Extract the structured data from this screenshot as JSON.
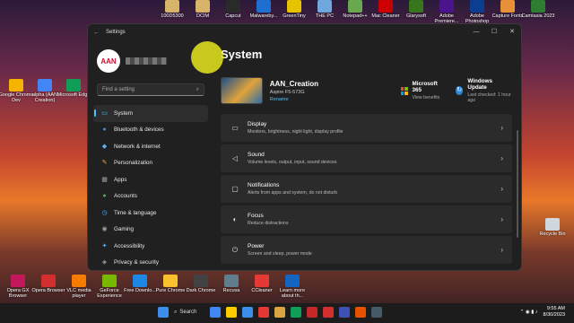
{
  "desktop": {
    "top_icons": [
      {
        "label": "100D5300",
        "color": "#d8b36a"
      },
      {
        "label": "DCIM",
        "color": "#d8b36a"
      },
      {
        "label": "Capcut",
        "color": "#2a2a2a"
      },
      {
        "label": "Malwareby...",
        "color": "#1f6fd1"
      },
      {
        "label": "GreenTiny",
        "color": "#e6c200"
      },
      {
        "label": "THE PC",
        "color": "#6fa8dc"
      },
      {
        "label": "Notepad++",
        "color": "#6aa84f"
      },
      {
        "label": "Mac Cleaner",
        "color": "#cc0000"
      },
      {
        "label": "Glarysoft",
        "color": "#38761d"
      },
      {
        "label": "Adobe Premiere...",
        "color": "#4a148c"
      },
      {
        "label": "Adobe Photoshop",
        "color": "#0b3d91"
      },
      {
        "label": "Capture Fonts",
        "color": "#e69138"
      },
      {
        "label": "Camtasia 2023",
        "color": "#2e7d32"
      }
    ],
    "left_icons": [
      {
        "label": "Google Chrome Dev",
        "color": "#f4b400"
      },
      {
        "label": "alpha (AAN Creation)",
        "color": "#4285f4"
      },
      {
        "label": "Microsoft Edge",
        "color": "#0f9d58"
      }
    ],
    "bottom_icons": [
      {
        "label": "Opera GX Browser",
        "color": "#c2185b"
      },
      {
        "label": "Opera Browser",
        "color": "#d32f2f"
      },
      {
        "label": "VLC media player",
        "color": "#f57c00"
      },
      {
        "label": "GeForce Experience",
        "color": "#76b900"
      },
      {
        "label": "Free Downlo...",
        "color": "#1e88e5"
      },
      {
        "label": "Pure Chrome",
        "color": "#fbc02d"
      },
      {
        "label": "Dark Chrome",
        "color": "#424242"
      },
      {
        "label": "Recuva",
        "color": "#607d8b"
      },
      {
        "label": "CCleaner",
        "color": "#e53935"
      },
      {
        "label": "Learn more about th...",
        "color": "#1565c0"
      }
    ],
    "recycle_bin": "Recycle Bin"
  },
  "window": {
    "title": "Settings",
    "back_glyph": "←",
    "controls": {
      "minimize": "—",
      "maximize": "☐",
      "close": "✕"
    }
  },
  "sidebar": {
    "avatar_text": "AAN",
    "search_placeholder": "Find a setting",
    "search_icon": "⌕",
    "items": [
      {
        "label": "System",
        "icon": "▭",
        "color": "#4cc2ff",
        "active": true
      },
      {
        "label": "Bluetooth & devices",
        "icon": "●",
        "color": "#3b8eea",
        "active": false
      },
      {
        "label": "Network & internet",
        "icon": "◆",
        "color": "#5fb2f0",
        "active": false
      },
      {
        "label": "Personalization",
        "icon": "✎",
        "color": "#e8a35a",
        "active": false
      },
      {
        "label": "Apps",
        "icon": "▦",
        "color": "#9aa0a6",
        "active": false
      },
      {
        "label": "Accounts",
        "icon": "●",
        "color": "#4caf50",
        "active": false
      },
      {
        "label": "Time & language",
        "icon": "◷",
        "color": "#5fb2f0",
        "active": false
      },
      {
        "label": "Gaming",
        "icon": "◉",
        "color": "#9aa0a6",
        "active": false
      },
      {
        "label": "Accessibility",
        "icon": "✦",
        "color": "#5fb2f0",
        "active": false
      },
      {
        "label": "Privacy & security",
        "icon": "◈",
        "color": "#9aa0a6",
        "active": false
      }
    ]
  },
  "main": {
    "title": "System",
    "device": {
      "name": "AAN_Creation",
      "model": "Aspire F5-573G",
      "rename": "Rename"
    },
    "quick_links": [
      {
        "title": "Microsoft 365",
        "sub": "View benefits"
      },
      {
        "title": "Windows Update",
        "sub": "Last checked: 1 hour ago"
      }
    ],
    "cards": [
      {
        "icon": "▭",
        "title": "Display",
        "sub": "Monitors, brightness, night light, display profile"
      },
      {
        "icon": "◁",
        "title": "Sound",
        "sub": "Volume levels, output, input, sound devices"
      },
      {
        "icon": "▢",
        "title": "Notifications",
        "sub": "Alerts from apps and system, do not disturb"
      },
      {
        "icon": "◐",
        "title": "Focus",
        "sub": "Reduce distractions"
      },
      {
        "icon": "⏻",
        "title": "Power",
        "sub": "Screen and sleep, power mode"
      }
    ],
    "chevron": "›"
  },
  "taskbar": {
    "search_label": "Search",
    "apps": [
      "#4285f4",
      "#ffcc00",
      "#3b8eea",
      "#e53935",
      "#d9a441",
      "#0f9d58",
      "#c62828",
      "#d32f2f",
      "#3f51b5",
      "#e65100",
      "#455a64"
    ],
    "time": "9:55 AM",
    "date": "8/30/2023",
    "tray_glyphs": "⌃ ◉ ▮ ♪"
  }
}
